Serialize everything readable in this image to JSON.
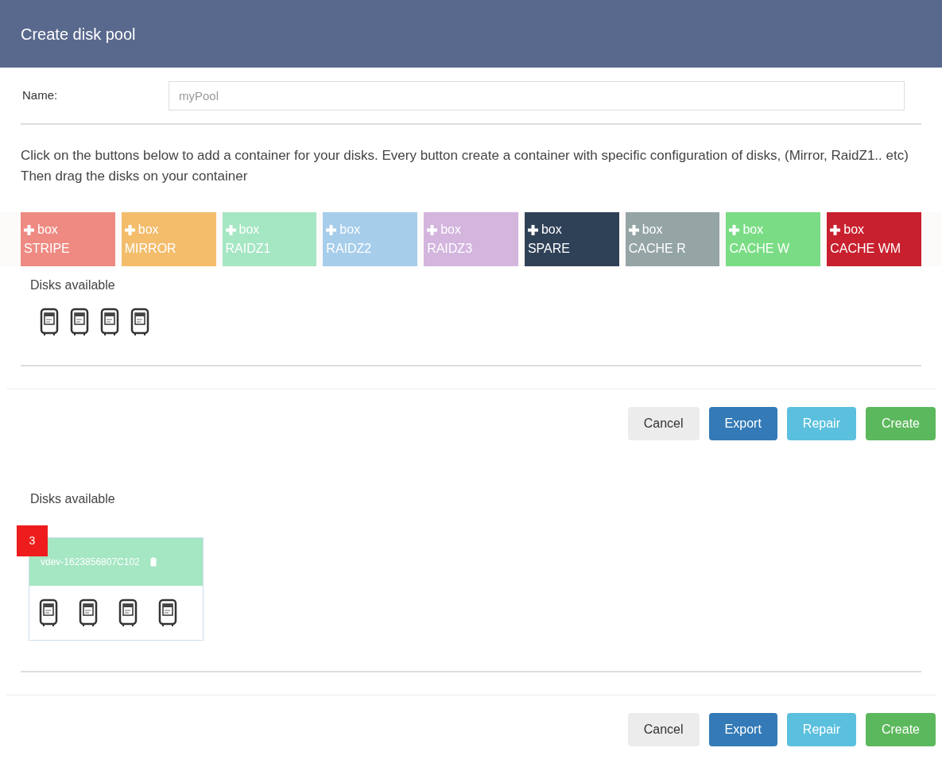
{
  "window": {
    "title": "Create disk pool"
  },
  "name_field": {
    "label": "Name:",
    "placeholder": "myPool"
  },
  "instructions": "Click on the buttons below to add a container for your disks. Every button create a container with specific configuration of disks, (Mirror, RaidZ1.. etc) Then drag the disks on your container",
  "box_buttons": [
    {
      "action": "box",
      "label": "STRIPE",
      "color": "#ee8a82"
    },
    {
      "action": "box",
      "label": "MIRROR",
      "color": "#f3bd6c"
    },
    {
      "action": "box",
      "label": "RAIDZ1",
      "color": "#a5e6c3"
    },
    {
      "action": "box",
      "label": "RAIDZ2",
      "color": "#a6cdea"
    },
    {
      "action": "box",
      "label": "RAIDZ3",
      "color": "#d3b5de"
    },
    {
      "action": "box",
      "label": "SPARE",
      "color": "#2f4157"
    },
    {
      "action": "box",
      "label": "CACHE R",
      "color": "#95a4a4"
    },
    {
      "action": "box",
      "label": "CACHE W",
      "color": "#7add85"
    },
    {
      "action": "box",
      "label": "CACHE WM",
      "color": "#c8202e"
    }
  ],
  "available": {
    "heading": "Disks available",
    "disks": [
      {
        "kind": "disk"
      },
      {
        "kind": "disk"
      },
      {
        "kind": "disk"
      },
      {
        "kind": "disk"
      }
    ]
  },
  "footer_1": [
    {
      "label": "Cancel",
      "kind": "default"
    },
    {
      "label": "Export",
      "kind": "primary"
    },
    {
      "label": "Repair",
      "kind": "info"
    },
    {
      "label": "Create",
      "kind": "success"
    }
  ],
  "section_2": {
    "heading": "Disks available",
    "vdev": {
      "badge": "3",
      "name": "vdev-1623856807C102",
      "color": "#a5e6c3",
      "disks": [
        {
          "kind": "disk"
        },
        {
          "kind": "disk"
        },
        {
          "kind": "disk"
        },
        {
          "kind": "disk"
        }
      ]
    }
  },
  "footer_2": [
    {
      "label": "Cancel",
      "kind": "default"
    },
    {
      "label": "Export",
      "kind": "primary"
    },
    {
      "label": "Repair",
      "kind": "info"
    },
    {
      "label": "Create",
      "kind": "success"
    }
  ]
}
